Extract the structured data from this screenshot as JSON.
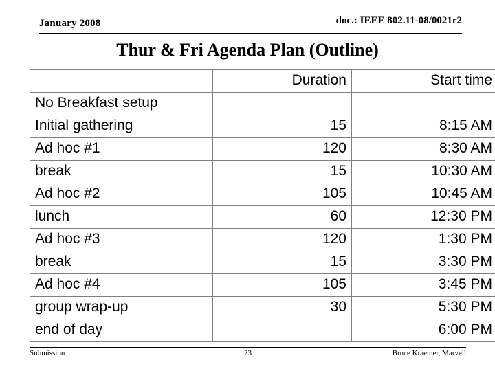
{
  "header": {
    "date": "January 2008",
    "doc": "doc.: IEEE 802.11-08/0021r2"
  },
  "title": "Thur & Fri Agenda Plan (Outline)",
  "table": {
    "columns": [
      "",
      "Duration",
      "Start time"
    ],
    "rows": [
      {
        "task": "No Breakfast setup",
        "duration": "",
        "start": ""
      },
      {
        "task": "Initial gathering",
        "duration": "15",
        "start": "8:15 AM"
      },
      {
        "task": "Ad hoc #1",
        "duration": "120",
        "start": "8:30 AM"
      },
      {
        "task": "break",
        "duration": "15",
        "start": "10:30 AM"
      },
      {
        "task": "Ad hoc #2",
        "duration": "105",
        "start": "10:45 AM"
      },
      {
        "task": "lunch",
        "duration": "60",
        "start": "12:30 PM"
      },
      {
        "task": "Ad hoc #3",
        "duration": "120",
        "start": "1:30 PM"
      },
      {
        "task": "break",
        "duration": "15",
        "start": "3:30 PM"
      },
      {
        "task": "Ad hoc #4",
        "duration": "105",
        "start": "3:45 PM"
      },
      {
        "task": "group wrap-up",
        "duration": "30",
        "start": "5:30 PM"
      },
      {
        "task": "end of day",
        "duration": "",
        "start": "6:00 PM"
      }
    ]
  },
  "footer": {
    "left": "Submission",
    "page": "23",
    "right": "Bruce Kraemer, Marvell"
  }
}
